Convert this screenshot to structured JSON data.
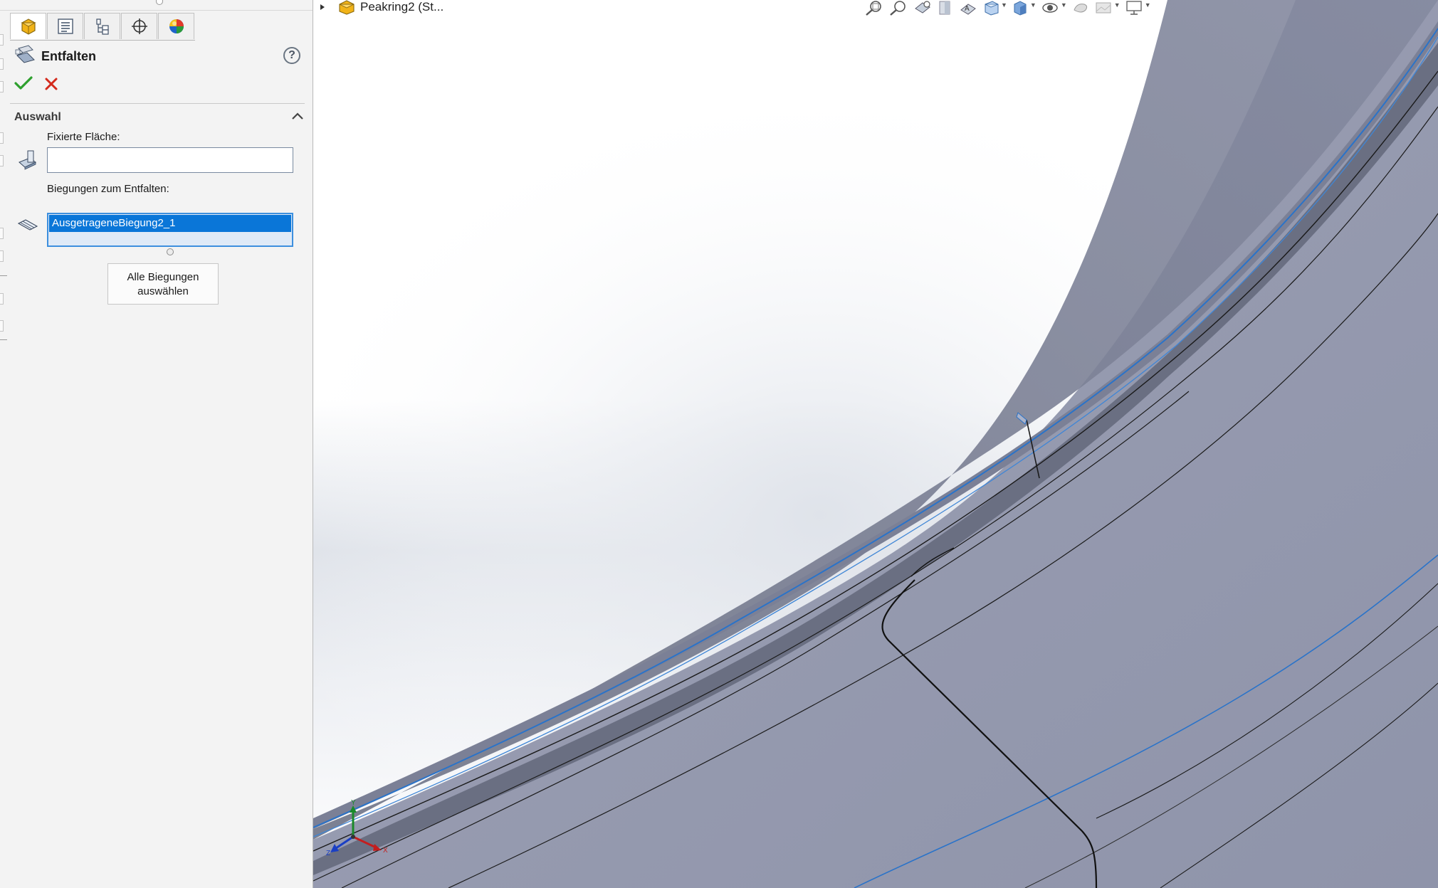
{
  "property_manager": {
    "title": "Entfalten",
    "help_label": "?",
    "tabs": [
      "feature-manager-tab",
      "property-manager-tab",
      "configuration-manager-tab",
      "dim-xpert-tab",
      "display-manager-tab"
    ],
    "selection_group": {
      "title": "Auswahl",
      "fixed_face_label": "Fixierte Fläche:",
      "fixed_face_value": "",
      "bends_label": "Biegungen zum Entfalten:",
      "bends_list": [
        "AusgetrageneBiegung2_1"
      ],
      "collect_all_button": "Alle Biegungen\nauswählen"
    }
  },
  "viewport": {
    "tree_item": "Peakring2 (St...",
    "toolbar_icons": [
      "zoom-to-fit-icon",
      "zoom-to-area-icon",
      "previous-view-icon",
      "section-view-icon",
      "dynamic-annotation-icon",
      "view-orientation-icon",
      "display-style-icon",
      "hide-show-items-icon",
      "edit-appearance-icon",
      "apply-scene-icon",
      "view-settings-icon"
    ],
    "triad_labels": {
      "x": "X",
      "y": "Y",
      "z": "Z"
    }
  },
  "colors": {
    "selection": "#0a76d8",
    "model_face": "#8e93a8",
    "model_edge_highlight": "#2a73c9",
    "background_top": "#ffffff",
    "background_gradient": "#dfe3ea"
  }
}
